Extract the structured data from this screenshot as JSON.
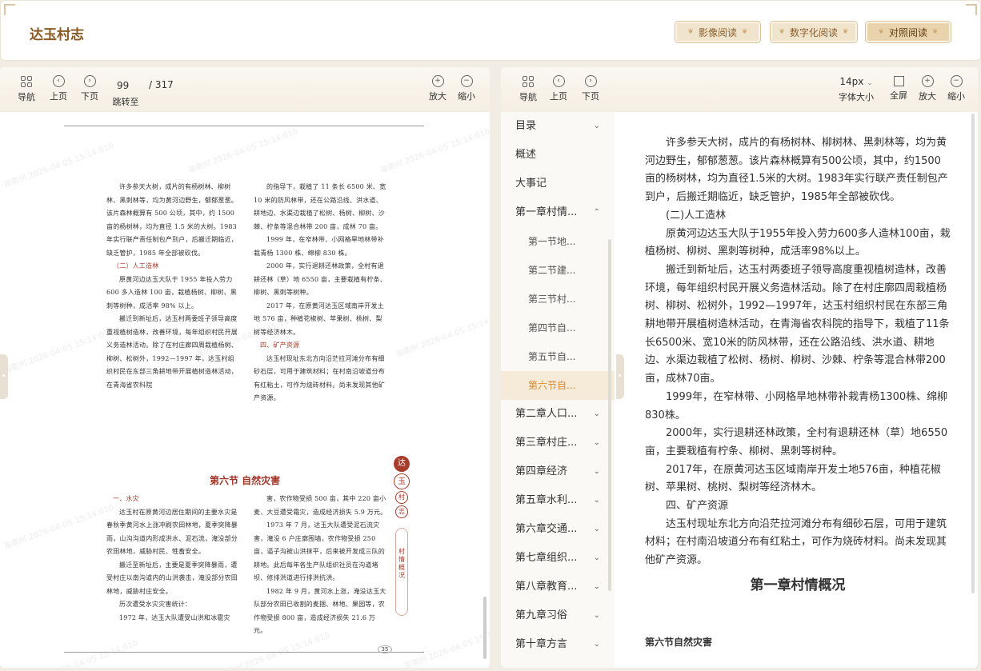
{
  "header": {
    "title": "达玉村志",
    "buttons": [
      "影像阅读",
      "数字化阅读",
      "对照阅读"
    ]
  },
  "left_toolbar": {
    "nav": "导航",
    "prev": "上页",
    "next": "下页",
    "jump": "跳转至",
    "page_value": "99",
    "page_total": "/ 317",
    "zoom_in": "放大",
    "zoom_out": "缩小"
  },
  "right_toolbar": {
    "nav": "导航",
    "prev": "上页",
    "next": "下页",
    "font_size": "14px",
    "font_label": "字体大小",
    "fullscreen": "全屏",
    "zoom_in": "放大",
    "zoom_out": "缩小"
  },
  "scan": {
    "col1_paras": [
      "许多参天大树，成片的有杨树林、柳树林、黑刺林等，均为黄河边野生，郁郁葱葱。该片森林概算有 500 公顷，其中，约 1500 亩的杨树林，均为直径 1.5 米的大树。1983 年实行联产责任制包产到户，后搬迁期临近，缺乏管护，1985 年全部被砍伐。",
      "（二）人工造林",
      "原黄河边达玉大队于 1955 年投入劳力 600 多人造林 100 亩，栽植杨树、柳树、黑刺等树种，成活率 98% 以上。",
      "搬迁到新址后，达玉村两委班子领导高度重视植树造林，改善环境，每年组织村民开展义务造林活动。除了在村庄廊四周栽植杨树、柳树、松树外，1992—1997 年，达玉村组织村民在东部三角耕地带开展植树造林活动，在青海省农科院"
    ],
    "col2_paras": [
      "的指导下，栽植了 11 条长 6500 米、宽 10 米的防风林带，还在公路沿线、洪水道、耕地边、水渠边栽植了松树、杨树、柳树、沙棘、柠条等混合林带 200 亩，成林 70 亩。",
      "1999 年，在窄林带、小网格旱地林带补栽青杨 1300 株、绵柳 830 株。",
      "2000 年，实行退耕还林政策，全村有退耕还林（草）地 6550 亩，主要栽植有柠条、柳树、黑刺等树种。",
      "2017 年，在原黄河达玉区域南岸开发土地 576 亩，种植花椒树、苹果树、桃树、梨树等经济林木。",
      "四、矿产资源",
      "达玉村现址东北方向沿茫拉河滩分布有细砂石层，可用于建筑材料；在村南沿坡道分布有红粘土，可作为烧砖材料。尚未发现其他矿产资源。"
    ],
    "section_title": "第六节 自然灾害",
    "col3_paras": [
      "一、水灾",
      "达玉村在原黄河边居住期间的主要水灾是春秋季黄河水上涨冲刷农田林地，夏季突降暴雨，山沟沟道内形成洪水、泥石流，淹没部分农田林地，威胁村民、牲畜安全。",
      "搬迁至新址后，主要是夏季突降暴雨，遭受村庄以南沟道内的山洪袭击，淹没部分农田林地，威胁村庄安全。",
      "历次遭受水灾灾害统计：",
      "1972 年，达玉大队遭受山洪和冰雹灾"
    ],
    "col4_paras": [
      "害，农作物受损 500 亩，其中 220 亩小麦、大豆遭受霜灾，造成经济损失 5.9 万元。",
      "1973 年 7 月，达玉大队遭受泥石流灾害，淹没 6 户庄廓围墙，农作物受损 250 亩，逼子沟被山洪抹平，后来被开发成三队的耕地。此后每年各生产队组织社员在沟道堵坝、修排洪道进行排洪抗洪。",
      "1982 年 9 月，黄河水上涨，淹没达玉大队部分农田已收割的麦捆、林地、果园等，农作物受损 800 亩，造成经济损失 21.6 万元。"
    ],
    "page_number": "35",
    "seal_chars": [
      "达",
      "玉",
      "村",
      "志"
    ],
    "side_tab": "村情概况",
    "watermark": "海南州 2026-04-05 15:14:010"
  },
  "toc": [
    {
      "label": "目录",
      "chevron": "⌄"
    },
    {
      "label": "概述"
    },
    {
      "label": "大事记"
    },
    {
      "label": "第一章村情...",
      "chevron": "⌃"
    },
    {
      "label": "第一节地...",
      "child": true
    },
    {
      "label": "第二节建...",
      "child": true
    },
    {
      "label": "第三节村...",
      "child": true
    },
    {
      "label": "第四节自...",
      "child": true
    },
    {
      "label": "第五节自...",
      "child": true
    },
    {
      "label": "第六节自...",
      "child": true,
      "active": true
    },
    {
      "label": "第二章人口...",
      "chevron": "⌄"
    },
    {
      "label": "第三章村庄...",
      "chevron": "⌄"
    },
    {
      "label": "第四章经济",
      "chevron": "⌄"
    },
    {
      "label": "第五章水利...",
      "chevron": "⌄"
    },
    {
      "label": "第六章交通...",
      "chevron": "⌄"
    },
    {
      "label": "第七章组织...",
      "chevron": "⌄"
    },
    {
      "label": "第八章教育...",
      "chevron": "⌄"
    },
    {
      "label": "第九章习俗",
      "chevron": "⌄"
    },
    {
      "label": "第十章方言",
      "chevron": "⌄"
    }
  ],
  "reading": {
    "paras": [
      "许多参天大树，成片的有杨树林、柳树林、黑刺林等，均为黄河边野生，郁郁葱葱。该片森林概算有500公顷，其中，约1500亩的杨树林，均为直径1.5米的大树。1983年实行联产责任制包产到户，后搬迁期临近，缺乏管护，1985年全部被砍伐。",
      "(二)人工造林",
      "原黄河边达玉大队于1955年投入劳力600多人造林100亩，栽植杨树、柳树、黑刺等树种，成活率98%以上。",
      "搬迁到新址后，达玉村两委班子领导高度重视植树造林，改善环境，每年组织村民开展义务造林活动。除了在村庄廓四周栽植杨树、柳树、松树外，1992—1997年，达玉村组织村民在东部三角耕地带开展植树造林活动，在青海省农科院的指导下，栽植了11条长6500米、宽10米的防风林带，还在公路沿线、洪水道、耕地边、水渠边栽植了松树、杨树、柳树、沙棘、柠条等混合林带200亩，成林70亩。",
      "1999年，在窄林带、小网格旱地林带补栽青杨1300株、绵柳830株。",
      "2000年，实行退耕还林政策，全村有退耕还林（草）地6550亩，主要栽植有柠条、柳树、黑刺等树种。",
      "2017年，在原黄河达玉区域南岸开发土地576亩，种植花椒树、苹果树、桃树、梨树等经济林木。",
      "四、矿产资源",
      "达玉村现址东北方向沿茫拉河滩分布有细砂石层，可用于建筑材料；在村南沿坡道分布有红粘土，可作为烧砖材料。尚未发现其他矿产资源。"
    ],
    "chapter_title": "第一章村情概况",
    "section_heading": "第六节自然灾害"
  },
  "colors": {
    "accent": "#d88a2f",
    "brand": "#8a5a25",
    "seal_red": "#a83c2a"
  }
}
